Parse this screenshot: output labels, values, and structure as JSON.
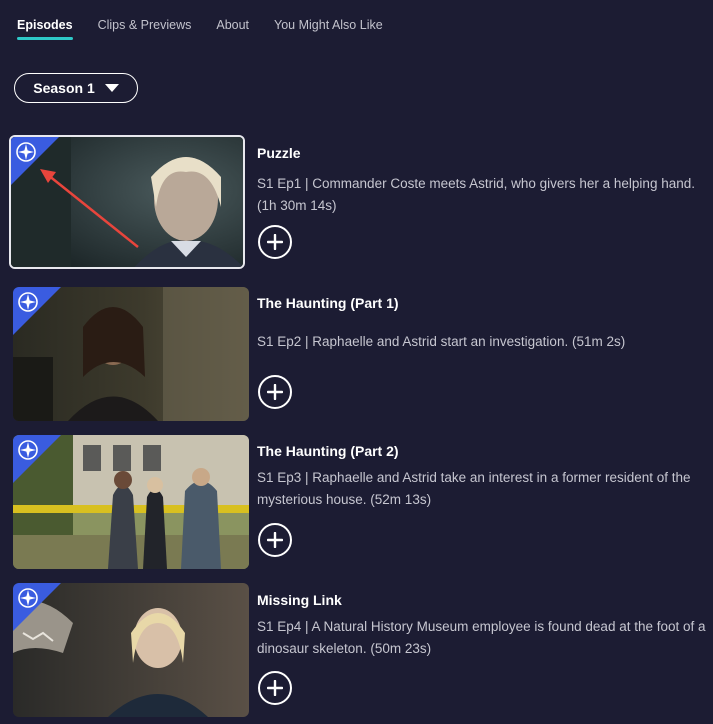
{
  "tabs": [
    {
      "label": "Episodes",
      "active": true
    },
    {
      "label": "Clips & Previews",
      "active": false
    },
    {
      "label": "About",
      "active": false
    },
    {
      "label": "You Might Also Like",
      "active": false
    }
  ],
  "season": {
    "label": "Season 1"
  },
  "episodes": [
    {
      "title": "Puzzle",
      "description": "S1 Ep1 | Commander Coste meets Astrid, who givers her a helping hand. (1h 30m 14s)",
      "selected": true
    },
    {
      "title": "The Haunting (Part 1)",
      "description": "S1 Ep2 | Raphaelle and Astrid start an investigation. (51m 2s)",
      "selected": false
    },
    {
      "title": "The Haunting (Part 2)",
      "description": "S1 Ep3 | Raphaelle and Astrid take an interest in a former resident of the mysterious house. (52m 13s)",
      "selected": false
    },
    {
      "title": "Missing Link",
      "description": "S1 Ep4 | A Natural History Museum employee is found dead at the foot of a dinosaur skeleton. (50m 23s)",
      "selected": false
    }
  ],
  "colors": {
    "background": "#1c1c33",
    "tab_underline": "#2ec8c8",
    "badge": "#3a5ce0",
    "annotation_arrow": "#e8453c"
  },
  "icons": {
    "badge": "compass-icon",
    "add": "plus-icon",
    "season_caret": "caret-down-icon"
  }
}
